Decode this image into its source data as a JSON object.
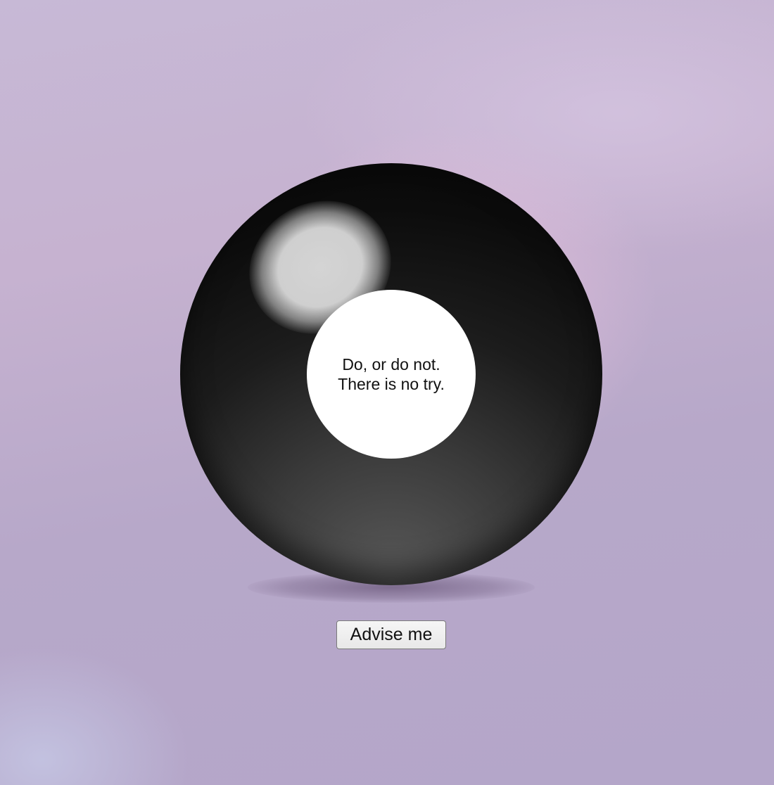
{
  "magic_ball": {
    "answer_lines": [
      "Do, or do not.",
      "There is no try."
    ]
  },
  "actions": {
    "advise_label": "Advise me"
  }
}
